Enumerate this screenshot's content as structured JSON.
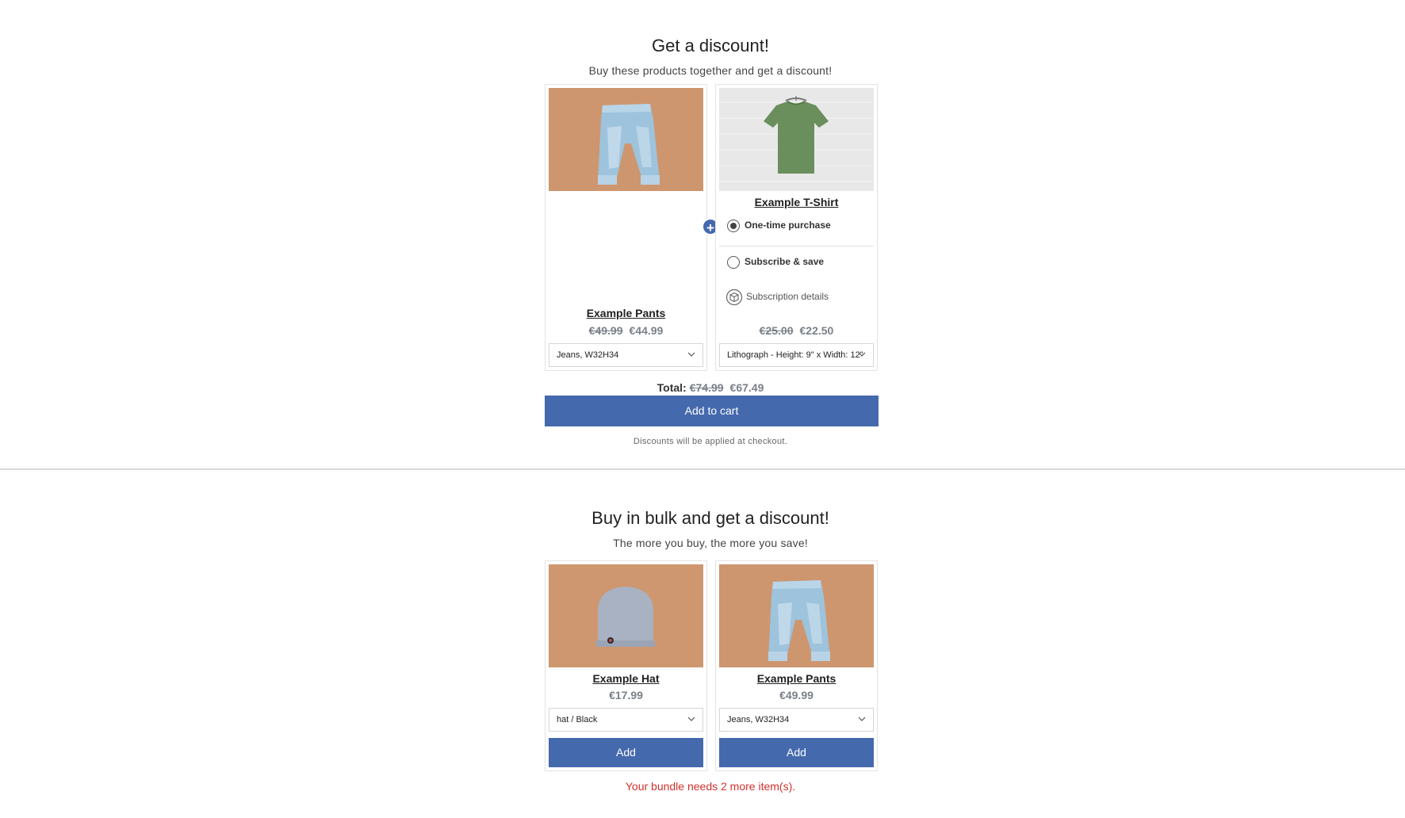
{
  "discount_section": {
    "title": "Get a discount!",
    "subtitle": "Buy these products together and get a discount!",
    "products": [
      {
        "name": "Example Pants",
        "price_old": "€49.99",
        "price_new": "€44.99",
        "variant": "Jeans, W32H34",
        "image": "jeans-photo"
      },
      {
        "name": "Example T-Shirt",
        "price_old": "€25.00",
        "price_new": "€22.50",
        "variant": "Lithograph - Height: 9\" x Width: 12\"",
        "image": "green-tshirt-photo",
        "purchase_options": {
          "one_time": "One-time purchase",
          "subscribe": "Subscribe & save",
          "subscription_details": "Subscription details",
          "selected": "one_time"
        }
      }
    ],
    "total_label": "Total:",
    "total_old": "€74.99",
    "total_new": "€67.49",
    "add_to_cart": "Add to cart",
    "note": "Discounts will be applied at checkout."
  },
  "bulk_section": {
    "title": "Buy in bulk and get a discount!",
    "subtitle": "The more you buy, the more you save!",
    "products": [
      {
        "name": "Example Hat",
        "price": "€17.99",
        "variant": "hat / Black",
        "add_label": "Add",
        "image": "grey-beanie-photo"
      },
      {
        "name": "Example Pants",
        "price": "€49.99",
        "variant": "Jeans, W32H34",
        "add_label": "Add",
        "image": "jeans-photo"
      }
    ],
    "warning": "Your bundle needs 2 more item(s)."
  },
  "colors": {
    "accent": "#4569ad",
    "warning": "#d0312d",
    "muted_price": "#7a8089"
  }
}
